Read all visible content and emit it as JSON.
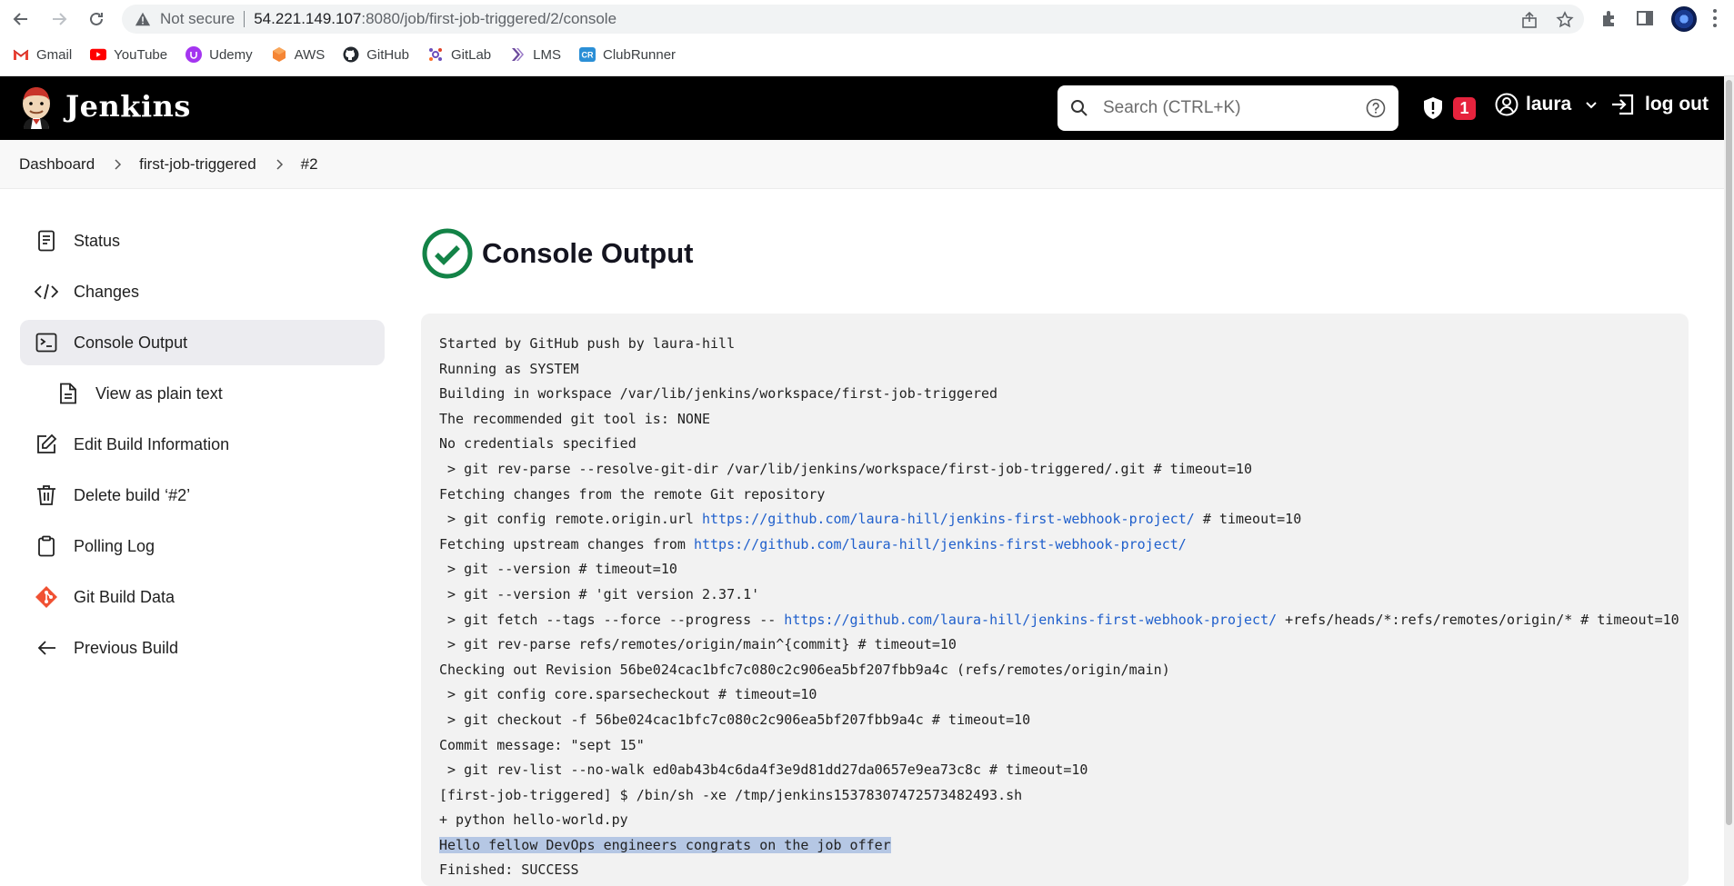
{
  "browser": {
    "not_secure": "Not secure",
    "url_host": "54.221.149.107",
    "url_path": ":8080/job/first-job-triggered/2/console",
    "bookmarks": [
      {
        "label": "Gmail",
        "icon": "gmail-icon"
      },
      {
        "label": "YouTube",
        "icon": "youtube-icon"
      },
      {
        "label": "Udemy",
        "icon": "udemy-icon"
      },
      {
        "label": "AWS",
        "icon": "aws-icon"
      },
      {
        "label": "GitHub",
        "icon": "github-icon"
      },
      {
        "label": "GitLab",
        "icon": "gitlab-icon"
      },
      {
        "label": "LMS",
        "icon": "lms-icon"
      },
      {
        "label": "ClubRunner",
        "icon": "clubrunner-icon"
      }
    ]
  },
  "header": {
    "title": "Jenkins",
    "search_placeholder": "Search (CTRL+K)",
    "alert_count": "1",
    "user": "laura",
    "logout": "log out"
  },
  "breadcrumb": [
    "Dashboard",
    "first-job-triggered",
    "#2"
  ],
  "sidebar": {
    "items": [
      {
        "label": "Status",
        "icon": "status-icon"
      },
      {
        "label": "Changes",
        "icon": "code-icon"
      },
      {
        "label": "Console Output",
        "icon": "terminal-icon"
      },
      {
        "label": "View as plain text",
        "icon": "document-icon"
      },
      {
        "label": "Edit Build Information",
        "icon": "edit-icon"
      },
      {
        "label": "Delete build ‘#2’",
        "icon": "trash-icon"
      },
      {
        "label": "Polling Log",
        "icon": "clipboard-icon"
      },
      {
        "label": "Git Build Data",
        "icon": "git-icon"
      },
      {
        "label": "Previous Build",
        "icon": "arrow-left-icon"
      }
    ]
  },
  "main": {
    "title": "Console Output",
    "console_lines": [
      {
        "text": "Started by GitHub push by laura-hill"
      },
      {
        "text": "Running as SYSTEM"
      },
      {
        "text": "Building in workspace /var/lib/jenkins/workspace/first-job-triggered"
      },
      {
        "text": "The recommended git tool is: NONE"
      },
      {
        "text": "No credentials specified"
      },
      {
        "text": " > git rev-parse --resolve-git-dir /var/lib/jenkins/workspace/first-job-triggered/.git # timeout=10"
      },
      {
        "text": "Fetching changes from the remote Git repository"
      },
      {
        "pre": " > git config remote.origin.url ",
        "link": "https://github.com/laura-hill/jenkins-first-webhook-project/",
        "post": " # timeout=10"
      },
      {
        "pre": "Fetching upstream changes from ",
        "link": "https://github.com/laura-hill/jenkins-first-webhook-project/",
        "post": ""
      },
      {
        "text": " > git --version # timeout=10"
      },
      {
        "text": " > git --version # 'git version 2.37.1'"
      },
      {
        "pre": " > git fetch --tags --force --progress -- ",
        "link": "https://github.com/laura-hill/jenkins-first-webhook-project/",
        "post": " +refs/heads/*:refs/remotes/origin/* # timeout=10"
      },
      {
        "text": " > git rev-parse refs/remotes/origin/main^{commit} # timeout=10"
      },
      {
        "text": "Checking out Revision 56be024cac1bfc7c080c2c906ea5bf207fbb9a4c (refs/remotes/origin/main)"
      },
      {
        "text": " > git config core.sparsecheckout # timeout=10"
      },
      {
        "text": " > git checkout -f 56be024cac1bfc7c080c2c906ea5bf207fbb9a4c # timeout=10"
      },
      {
        "text": "Commit message: \"sept 15\""
      },
      {
        "text": " > git rev-list --no-walk ed0ab43b4c6da4f3e9d81dd27da0657e9ea73c8c # timeout=10"
      },
      {
        "text": "[first-job-triggered] $ /bin/sh -xe /tmp/jenkins15378307472573482493.sh"
      },
      {
        "text": "+ python hello-world.py"
      },
      {
        "highlight": "Hello fellow DevOps engineers congrats on the job offer"
      },
      {
        "text": "Finished: SUCCESS"
      }
    ]
  },
  "colors": {
    "success": "#138347",
    "alert": "#e6233d",
    "link": "#1f5fcc"
  }
}
